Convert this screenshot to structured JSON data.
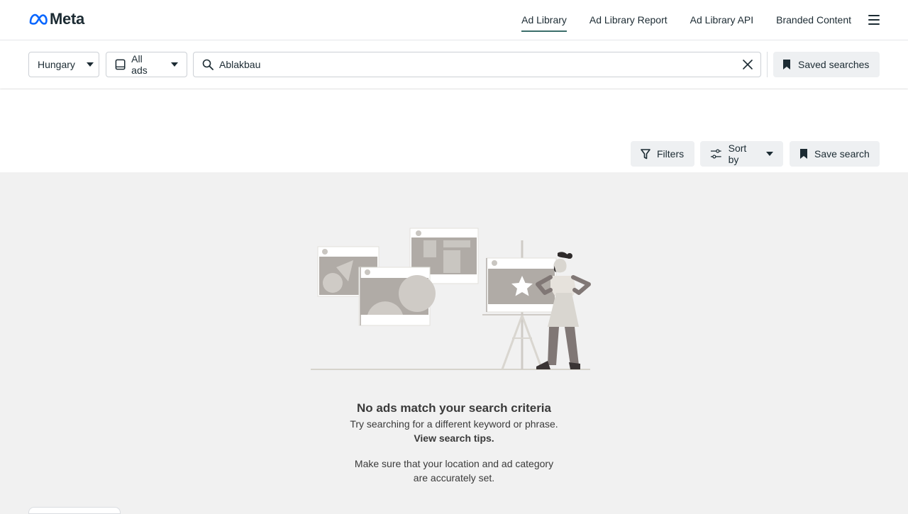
{
  "header": {
    "logo_text": "Meta",
    "nav": [
      {
        "label": "Ad Library",
        "active": true
      },
      {
        "label": "Ad Library Report",
        "active": false
      },
      {
        "label": "Ad Library API",
        "active": false
      },
      {
        "label": "Branded Content",
        "active": false
      }
    ],
    "menu_icon": "hamburger-menu-icon"
  },
  "search": {
    "country": "Hungary",
    "ad_type": "All ads",
    "query": "Ablakbau",
    "search_icon": "search-icon",
    "clear_icon": "close-icon",
    "saved_searches_label": "Saved searches"
  },
  "toolbar": {
    "filters_label": "Filters",
    "sort_label": "Sort by",
    "save_search_label": "Save search"
  },
  "empty_state": {
    "title": "No ads match your search criteria",
    "line1": "Try searching for a different keyword or phrase.",
    "link": "View search tips.",
    "line2": "Make sure that your location and ad category",
    "line3": "are accurately set."
  },
  "colors": {
    "accent_underline": "#3b6e6b",
    "meta_blue": "#0866ff",
    "button_bg": "#eef0f2",
    "empty_bg": "#f1f1f1"
  }
}
